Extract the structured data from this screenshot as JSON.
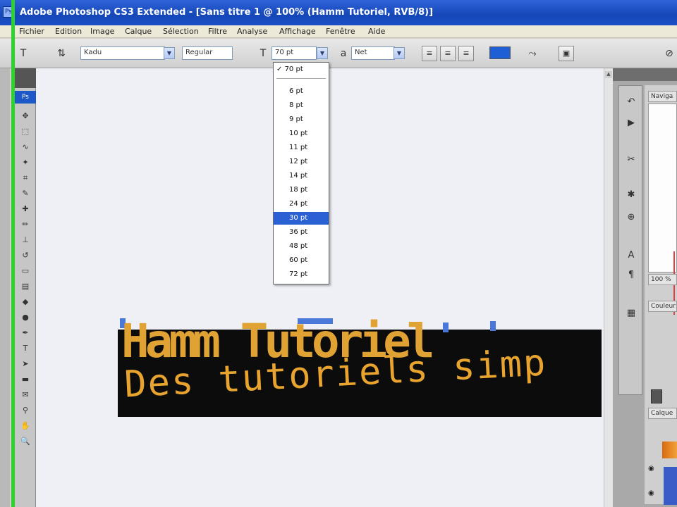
{
  "window": {
    "title": "Adobe Photoshop CS3 Extended - [Sans titre 1 @ 100% (Hamm Tutoriel, RVB/8)]"
  },
  "menu": [
    "Fichier",
    "Edition",
    "Image",
    "Calque",
    "Sélection",
    "Filtre",
    "Analyse",
    "Affichage",
    "Fenêtre",
    "Aide"
  ],
  "options_bar": {
    "font_family": "Kadu",
    "font_style": "Regular",
    "font_size": "70 pt",
    "antialias": "Net",
    "text_color": "#1f5fd6"
  },
  "font_size_dropdown": {
    "current": "70 pt",
    "items": [
      "6 pt",
      "8 pt",
      "9 pt",
      "10 pt",
      "11 pt",
      "12 pt",
      "14 pt",
      "18 pt",
      "24 pt",
      "30 pt",
      "36 pt",
      "48 pt",
      "60 pt",
      "72 pt"
    ],
    "highlighted": "30 pt"
  },
  "canvas": {
    "headline": "Hamm Tutoriel",
    "subline": "Des tutoriels simp",
    "text_color": "#e0a232",
    "banner_color": "#0c0c0c"
  },
  "right_panel": {
    "zoom_label": "100 %",
    "tabs": [
      "Naviga",
      "Couleur",
      "Calque"
    ]
  }
}
